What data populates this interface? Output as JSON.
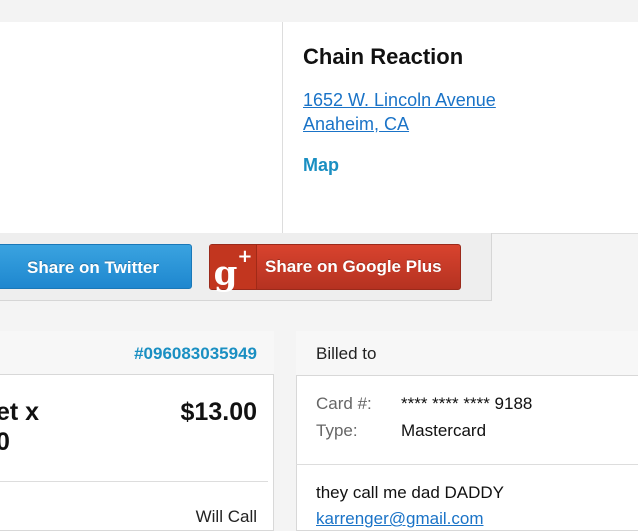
{
  "venue": {
    "name": "Chain Reaction",
    "address_line1": "1652 W. Lincoln Avenue",
    "address_line2": "Anaheim, CA",
    "map_label": "Map"
  },
  "share": {
    "twitter_label": "Share on Twitter",
    "gplus_icon_letter": "g",
    "gplus_icon_plus": "+",
    "gplus_label": "Share on Google Plus"
  },
  "order": {
    "number": "#096083035949",
    "ticket_line1": "et x",
    "ticket_line2": "0",
    "price": "$13.00",
    "delivery": "Will Call"
  },
  "billing": {
    "header": "Billed to",
    "card_label": "Card #:",
    "card_value": "**** **** **** 9188",
    "type_label": "Type:",
    "type_value": "Mastercard",
    "name": "they call me dad DADDY",
    "email": "karrenger@gmail.com"
  },
  "colors": {
    "link": "#1a73c7",
    "accent": "#1a8fc2",
    "twitter": "#2b95d8",
    "gplus": "#c8391f"
  }
}
